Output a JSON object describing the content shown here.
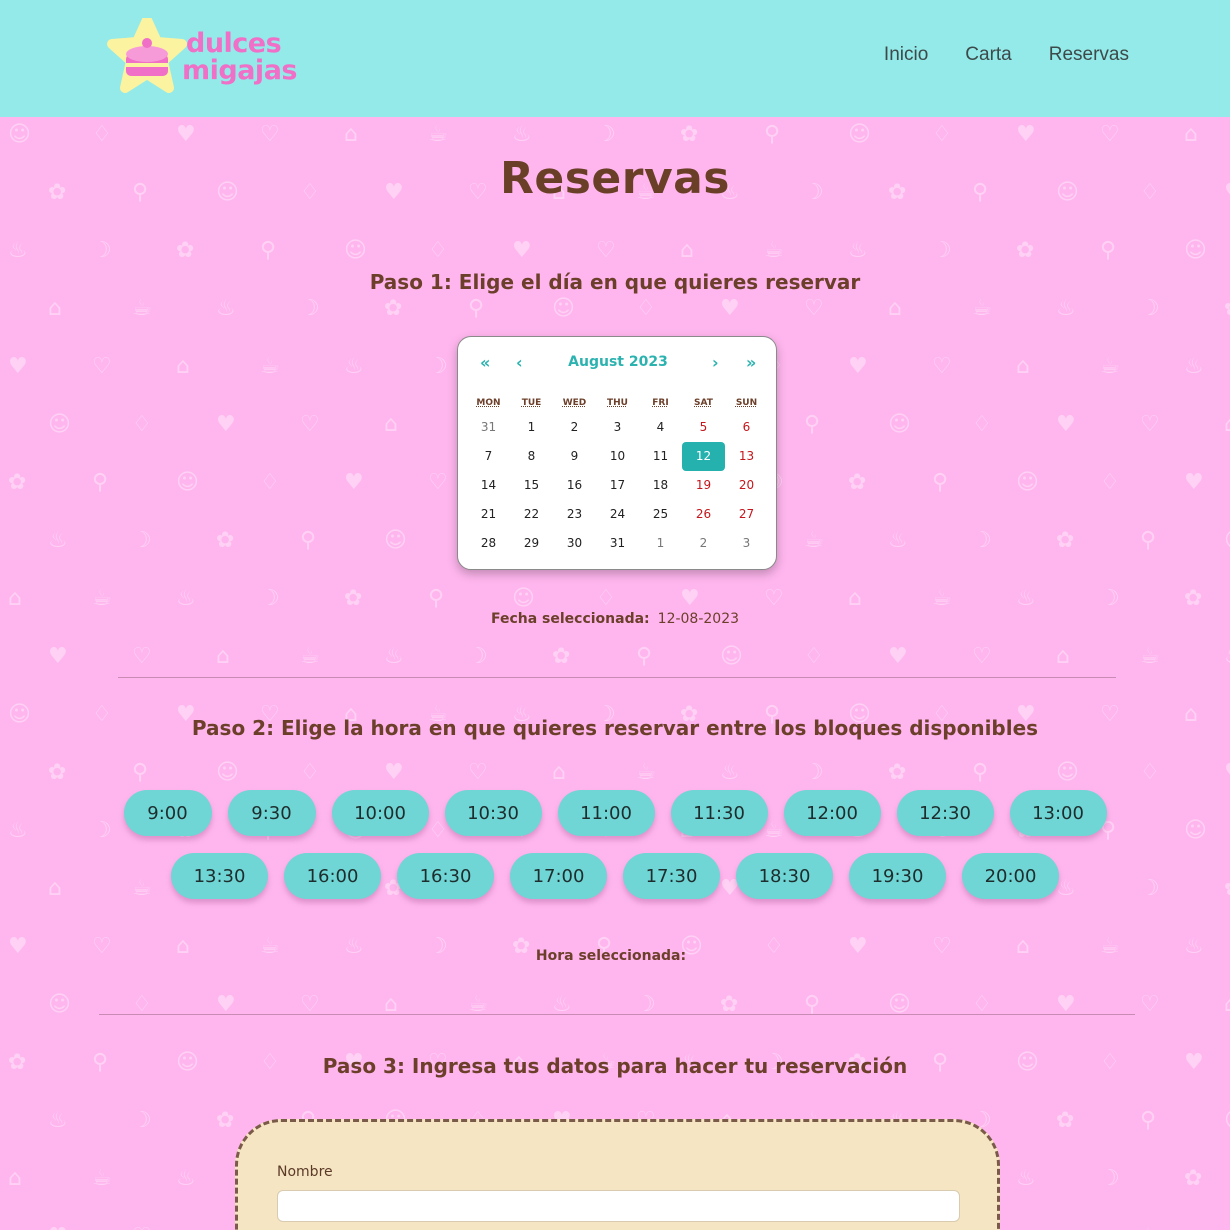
{
  "header": {
    "logo_line1": "dulces",
    "logo_line2": "migajas",
    "nav": [
      "Inicio",
      "Carta",
      "Reservas"
    ]
  },
  "main": {
    "title": "Reservas",
    "step1": "Paso 1: Elige el día en que quieres reservar",
    "step2": "Paso 2: Elige la hora en que quieres reservar entre los bloques disponibles",
    "step3": "Paso 3: Ingresa tus datos para hacer tu reservación"
  },
  "calendar": {
    "month_label": "August 2023",
    "prev_year": "«",
    "prev_month": "‹",
    "next_month": "›",
    "next_year": "»",
    "weekdays": [
      "MON",
      "TUE",
      "WED",
      "THU",
      "FRI",
      "SAT",
      "SUN"
    ],
    "weeks": [
      [
        "31",
        "1",
        "2",
        "3",
        "4",
        "5",
        "6"
      ],
      [
        "7",
        "8",
        "9",
        "10",
        "11",
        "12",
        "13"
      ],
      [
        "14",
        "15",
        "16",
        "17",
        "18",
        "19",
        "20"
      ],
      [
        "21",
        "22",
        "23",
        "24",
        "25",
        "26",
        "27"
      ],
      [
        "28",
        "29",
        "30",
        "31",
        "1",
        "2",
        "3"
      ]
    ],
    "other_month_cells": [
      "0-0",
      "4-4",
      "4-5",
      "4-6"
    ],
    "selected_cell": "1-5"
  },
  "selection": {
    "date_label": "Fecha seleccionada:",
    "date_value": "12-08-2023",
    "time_label": "Hora seleccionada:",
    "time_value": ""
  },
  "slots": {
    "row1": [
      "9:00",
      "9:30",
      "10:00",
      "10:30",
      "11:00",
      "11:30",
      "12:00",
      "12:30",
      "13:00"
    ],
    "row2": [
      "13:30",
      "16:00",
      "16:30",
      "17:00",
      "17:30",
      "18:30",
      "19:30",
      "20:00"
    ]
  },
  "form": {
    "name_label": "Nombre",
    "name_value": ""
  },
  "colors": {
    "header_bg": "#94eae9",
    "page_bg": "#ffb6ee",
    "accent": "#25b1ae",
    "slot_bg": "#6fd5d5",
    "title_brown": "#6a3f27",
    "form_bg": "#f6e5c2",
    "weekend_red": "#c4161c",
    "logo_pink": "#f06fc7"
  }
}
